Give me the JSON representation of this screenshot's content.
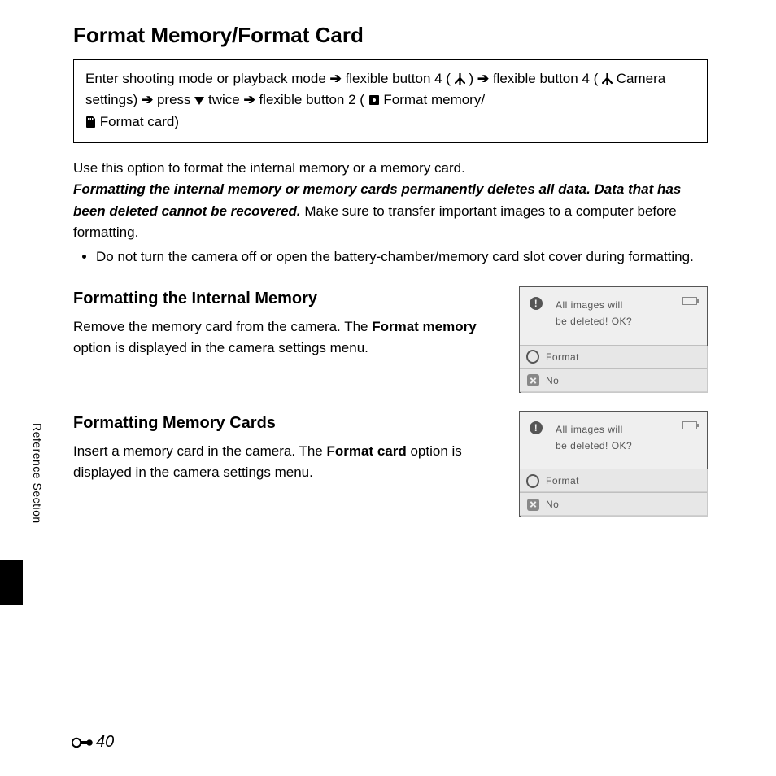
{
  "title": "Format Memory/Format Card",
  "nav": {
    "t1": "Enter shooting mode or playback mode ",
    "t2": " flexible button 4 (",
    "t3": ") ",
    "t4": " flexible button 4 (",
    "t5": " Camera settings) ",
    "t6": " press ",
    "t7": " twice ",
    "t8": " flexible button 2 (",
    "t9": " Format memory/",
    "t10": " Format card)"
  },
  "intro": {
    "line1": "Use this option to format the internal memory or a memory card.",
    "bold": "Formatting the internal memory or memory cards permanently deletes all data. Data that has been deleted cannot be recovered.",
    "after_bold": " Make sure to transfer important images to a computer before formatting.",
    "bullet1": "Do not turn the camera off or open the battery-chamber/memory card slot cover during formatting."
  },
  "section1": {
    "heading": "Formatting the Internal Memory",
    "before_b": "Remove the memory card from the camera. The ",
    "bold": "Format memory",
    "after_b": " option is displayed in the camera settings menu."
  },
  "section2": {
    "heading": "Formatting Memory Cards",
    "before_b": "Insert a memory card in the camera. The ",
    "bold": "Format card",
    "after_b": " option is displayed in the camera settings menu."
  },
  "screen": {
    "msg_l1": "All images will",
    "msg_l2": "be deleted! OK?",
    "opt_format": "Format",
    "opt_no": "No",
    "alert": "!"
  },
  "side_tab": "Reference Section",
  "page_number": "40"
}
